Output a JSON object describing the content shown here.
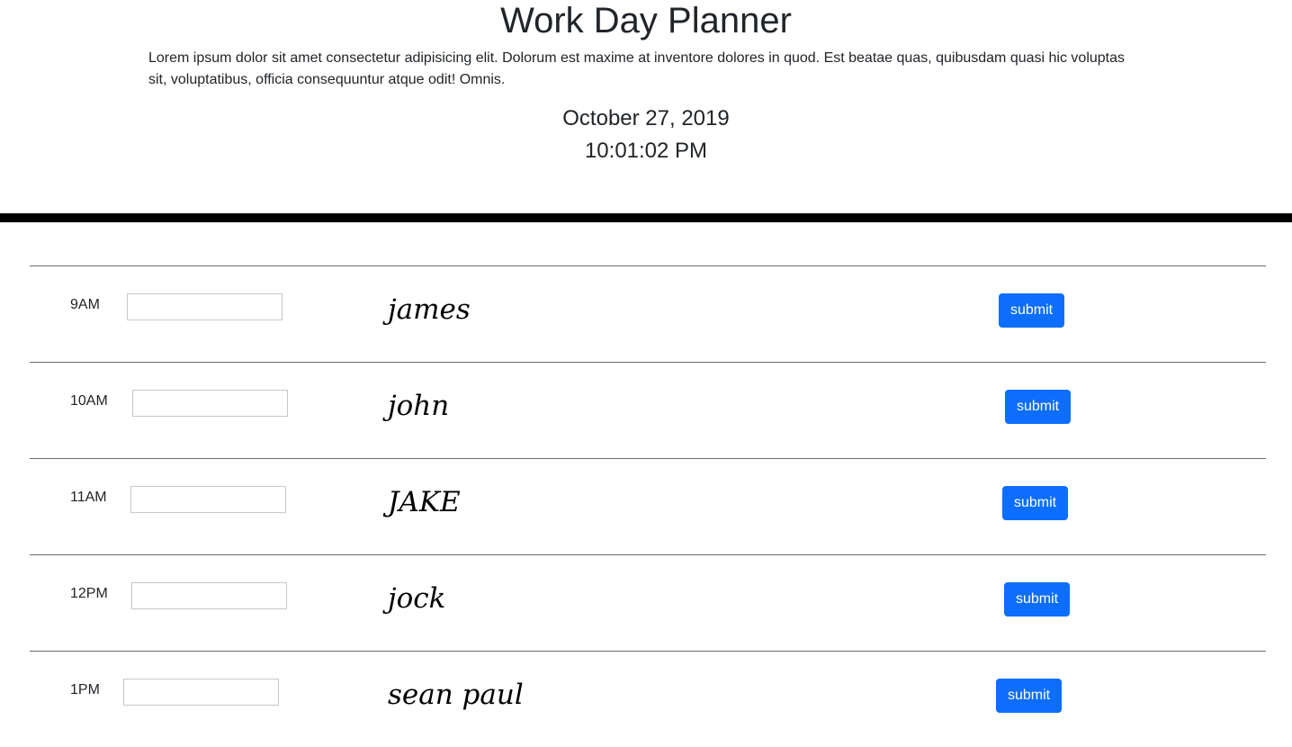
{
  "header": {
    "title": "Work Day Planner",
    "lead": "Lorem ipsum dolor sit amet consectetur adipisicing elit. Dolorum est maxime at inventore dolores in quod. Est beatae quas, quibusdam quasi hic voluptas sit, voluptatibus, officia consequuntur atque odit! Omnis.",
    "date": "October 27, 2019",
    "time": "10:01:02 PM"
  },
  "rows": [
    {
      "hour": "9AM",
      "input_value": "",
      "saved_text": "james",
      "button_label": "submit"
    },
    {
      "hour": "10AM",
      "input_value": "",
      "saved_text": "john",
      "button_label": "submit"
    },
    {
      "hour": "11AM",
      "input_value": "",
      "saved_text": "JAKE",
      "button_label": "submit"
    },
    {
      "hour": "12PM",
      "input_value": "",
      "saved_text": "jock",
      "button_label": "submit"
    },
    {
      "hour": "1PM",
      "input_value": "",
      "saved_text": "sean paul",
      "button_label": "submit"
    }
  ],
  "colors": {
    "button_bg": "#0d6efd",
    "divider": "#000000"
  }
}
